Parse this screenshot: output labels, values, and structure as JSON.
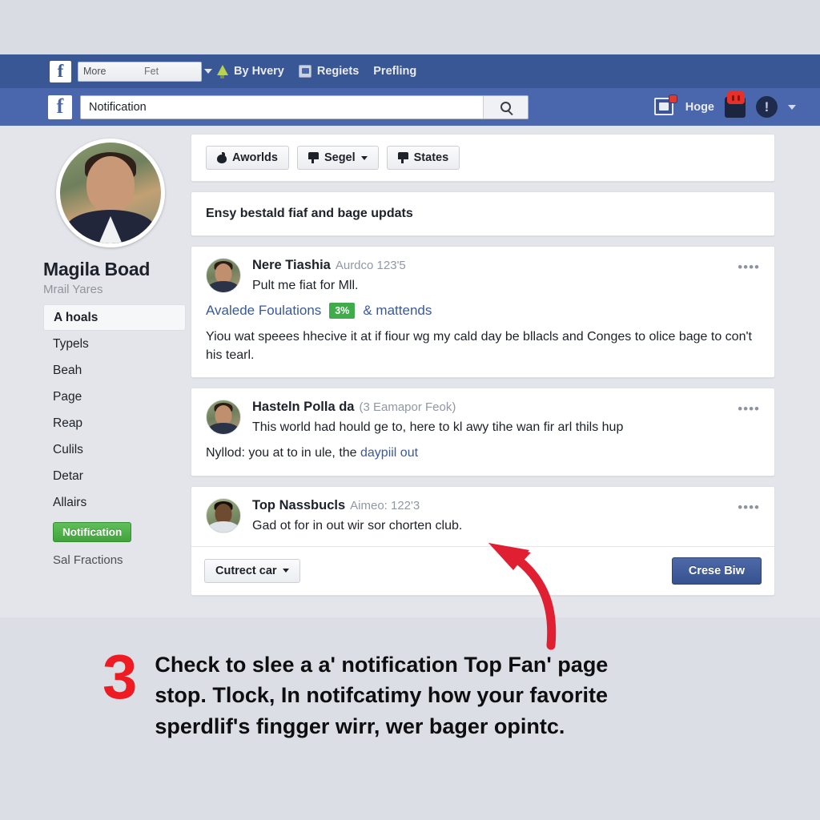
{
  "navbar_top": {
    "logo": "f",
    "select": {
      "value_left": "More",
      "value_right": "Fet"
    },
    "links": [
      {
        "label": "By Hvery",
        "icon": "tree-icon"
      },
      {
        "label": "Regiets",
        "icon": "document-icon"
      },
      {
        "label": "Prefling",
        "icon": ""
      }
    ]
  },
  "navbar_second": {
    "logo": "f",
    "search": {
      "value": "Notification",
      "placeholder": "Search",
      "icon": "search-icon"
    },
    "right": {
      "pages_icon": "pages-icon",
      "home_label": "Hoge",
      "messages_icon": "messages-icon",
      "account_icon": "account-icon",
      "caret": "chevron-down-icon"
    }
  },
  "sidebar": {
    "profile": {
      "name": "Magila Boad",
      "subtitle": "Mrail Yares"
    },
    "items": [
      {
        "label": "A hoals",
        "active": true
      },
      {
        "label": "Typels",
        "active": false
      },
      {
        "label": "Beah",
        "active": false
      },
      {
        "label": "Page",
        "active": false
      },
      {
        "label": "Reap",
        "active": false
      },
      {
        "label": "Culils",
        "active": false
      },
      {
        "label": "Detar",
        "active": false
      },
      {
        "label": "Allairs",
        "active": false
      }
    ],
    "badge": "Notification",
    "footer": "Sal Fractions"
  },
  "filters": [
    {
      "label": "Aworlds",
      "icon": "apple-icon",
      "caret": false
    },
    {
      "label": "Segel",
      "icon": "flag-icon",
      "caret": true
    },
    {
      "label": "States",
      "icon": "flag-icon",
      "caret": false
    }
  ],
  "banner": "Ensy bestald fiaf and bage updats",
  "notifications": [
    {
      "title": "Nere Tiashia",
      "meta": "Aurdco 123'5",
      "subtitle": "Pult me fiat for Mll.",
      "link_text": "Avalede Foulations",
      "pct_badge": "3%",
      "link_suffix": "& mattends",
      "body": "Yiou wat speees hhecive it at if fiour wg my cald day be bllacls and Conges to olice bage to con't his tearl.",
      "menu": "••••"
    },
    {
      "title": "Hasteln Polla da",
      "meta": "(3  Eamapor Feok)",
      "subtitle": "This world had hould ge to, here to kl awy tihe wan fir arl thils hup",
      "body_prefix": "Nyllod: you at to in ule, the ",
      "body_link": "daypiil out",
      "menu": "••••"
    },
    {
      "title": "Top Nassbucls",
      "meta": "Aimeo: 122'3",
      "subtitle": "Gad ot for in out wir sor chorten club.",
      "menu": "••••"
    }
  ],
  "card_footer": {
    "dropdown_label": "Cutrect car",
    "primary_label": "Crese Biw"
  },
  "caption": {
    "number": "3",
    "line1": "Check to slee a a' notification Top Fan' page",
    "line2": "stop. Tlock, In notifcatimy how your favorite",
    "line3": "sperdlif's fingger wirr, wer bager opintc."
  },
  "colors": {
    "navbar_top": "#3a5795",
    "navbar_second": "#4a67ad",
    "page_bg": "#e3e5ea",
    "accent_green": "#42a33c",
    "accent_red": "#ee1b22",
    "link_blue": "#3b5998"
  }
}
